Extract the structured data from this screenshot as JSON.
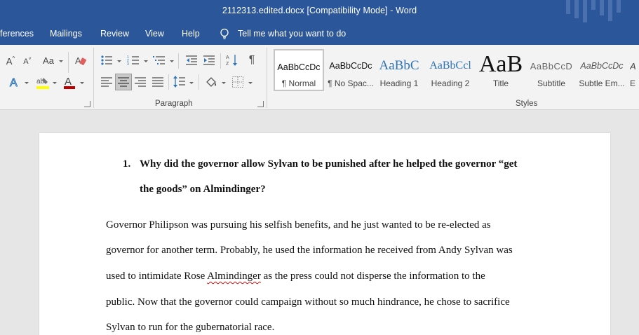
{
  "window": {
    "title": "2112313.edited.docx [Compatibility Mode]  -  Word"
  },
  "menu": {
    "tabs": [
      "ferences",
      "Mailings",
      "Review",
      "View",
      "Help"
    ],
    "tell_me": "Tell me what you want to do"
  },
  "ribbon": {
    "groups": {
      "paragraph": "Paragraph",
      "styles": "Styles"
    },
    "font": {
      "grow": "A",
      "shrink": "A",
      "change_case": "Aa"
    },
    "styles": [
      {
        "preview": "AaBbCcDc",
        "name": "¶ Normal"
      },
      {
        "preview": "AaBbCcDc",
        "name": "¶ No Spac..."
      },
      {
        "preview": "AaBbC",
        "name": "Heading 1"
      },
      {
        "preview": "AaBbCcl",
        "name": "Heading 2"
      },
      {
        "preview": "AaB",
        "name": "Title"
      },
      {
        "preview": "AaBbCcD",
        "name": "Subtitle"
      },
      {
        "preview": "AaBbCcDc",
        "name": "Subtle Em..."
      },
      {
        "preview": "A",
        "name": "E"
      }
    ]
  },
  "colors": {
    "title_bar": "#2b579a",
    "heading_blue": "#2e74b5",
    "highlight": "#ffff00",
    "font_color": "#c00000"
  },
  "document": {
    "question_number": "1.",
    "question_lines": [
      "Why did the governor allow Sylvan to be punished after he helped the governor “get",
      "the goods” on Almindinger?"
    ],
    "paragraph_lines": [
      "Governor Philipson was pursuing his selfish benefits, and he just wanted to be re-elected as",
      "governor for another term. Probably, he used the information he received from Andy Sylvan was",
      {
        "before": "used to intimidate Rose ",
        "misspelled": "Almindinger",
        "after": " as the press could not disperse the information to the"
      },
      "public. Now that the governor could campaign without so much hindrance, he chose to sacrifice",
      "Sylvan to run for the gubernatorial race."
    ]
  }
}
